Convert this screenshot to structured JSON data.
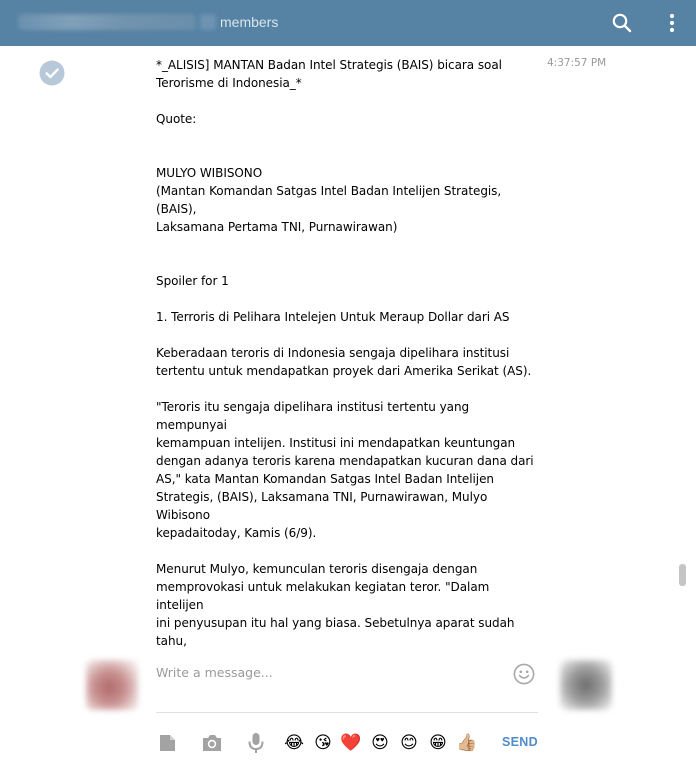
{
  "header": {
    "members_label": "members",
    "search_icon": "search-icon",
    "menu_icon": "more-vertical-icon",
    "bg_color": "#5682a3"
  },
  "message": {
    "time": "4:37:57 PM",
    "status_icon": "read-check-icon",
    "text": "*_ALISIS] MANTAN Badan Intel Strategis (BAIS) bicara soal\nTerorisme di Indonesia_*\n\nQuote:\n\n\nMULYO WIBISONO\n(Mantan Komandan Satgas Intel Badan Intelijen Strategis, (BAIS),\nLaksamana Pertama TNI, Purnawirawan)\n\n\nSpoiler for 1\n\n1. Terroris di Pelihara Intelejen Untuk Meraup Dollar dari AS\n\nKeberadaan teroris di Indonesia sengaja dipelihara institusi\ntertentu untuk mendapatkan proyek dari Amerika Serikat (AS).\n\n\"Teroris itu sengaja dipelihara institusi tertentu yang mempunyai\nkemampuan intelijen. Institusi ini mendapatkan keuntungan\ndengan adanya teroris karena mendapatkan kucuran dana dari\nAS,\" kata Mantan Komandan Satgas Intel Badan Intelijen\nStrategis, (BAIS), Laksamana TNI, Purnawirawan, Mulyo Wibisono\nkepadaitoday, Kamis (6/9).\n\nMenurut Mulyo, kemunculan teroris disengaja dengan\nmemprovokasi untuk melakukan kegiatan teror. \"Dalam intelijen\nini penyusupan itu hal yang biasa. Sebetulnya aparat sudah tahu,\ntetapi dibiarkan saja. Dan pelaku teroris ini akibat provokasi\nintelijen,\" paparnya.\n\nKata Mulyo, teroris Solo semakin mencurigakan karena aparat\nkepolisian menyebutkan para pelakunya melakukan pelatihan di"
  },
  "composer": {
    "placeholder": "Write a message...",
    "send_label": "SEND",
    "send_color": "#4f8cc9",
    "tools": [
      "document-icon",
      "camera-icon",
      "microphone-icon"
    ],
    "emojis": [
      "😂",
      "😘",
      "❤️",
      "😍",
      "😊",
      "😁",
      "👍🏼"
    ]
  }
}
